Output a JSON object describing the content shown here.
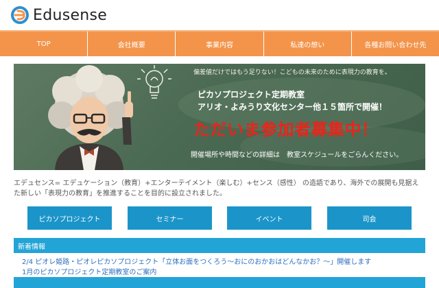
{
  "logo": {
    "text": "Edusense"
  },
  "nav": {
    "items": [
      {
        "label": "TOP"
      },
      {
        "label": "会社概要"
      },
      {
        "label": "事業内容"
      },
      {
        "label": "私達の想い"
      },
      {
        "label": "各種お問い合わせ先"
      }
    ]
  },
  "banner": {
    "tagline": "偏差値だけではもう足りない！こどもの未来のために表現力の教育を。",
    "line1": "ピカソプロジェクト定期教室",
    "line2": "アリオ・よみうり文化センター他１５箇所で開催！",
    "recruit": "ただいま参加者募集中！",
    "details": "開催場所や時間などの詳細は　教室スケジュールをごらんください。"
  },
  "intro": {
    "text": "エデュセンス= エデュケーション（教育）+エンターテイメント（楽しむ）+センス（感性） の造語であり、海外での展開も見据えた新しい「表現力の教育」を推進することを目的に設立されました。"
  },
  "buttons": [
    {
      "label": "ピカソプロジェクト"
    },
    {
      "label": "セミナー"
    },
    {
      "label": "イベント"
    },
    {
      "label": "司会"
    }
  ],
  "news": {
    "header": "新着情報",
    "items": [
      {
        "text": "2/4 ピオレ姫路・ピオレピカソプロジェクト「立体お面をつくろう～おにのおかおはどんなかお？～」開催します"
      },
      {
        "text": "1月のピカソプロジェクト定期教室のご案内"
      }
    ]
  },
  "colors": {
    "nav": "#f4944a",
    "button": "#1b95c9",
    "news_bar": "#23a4d6",
    "recruit_text": "#e8251b",
    "link": "#2b6fbf"
  }
}
